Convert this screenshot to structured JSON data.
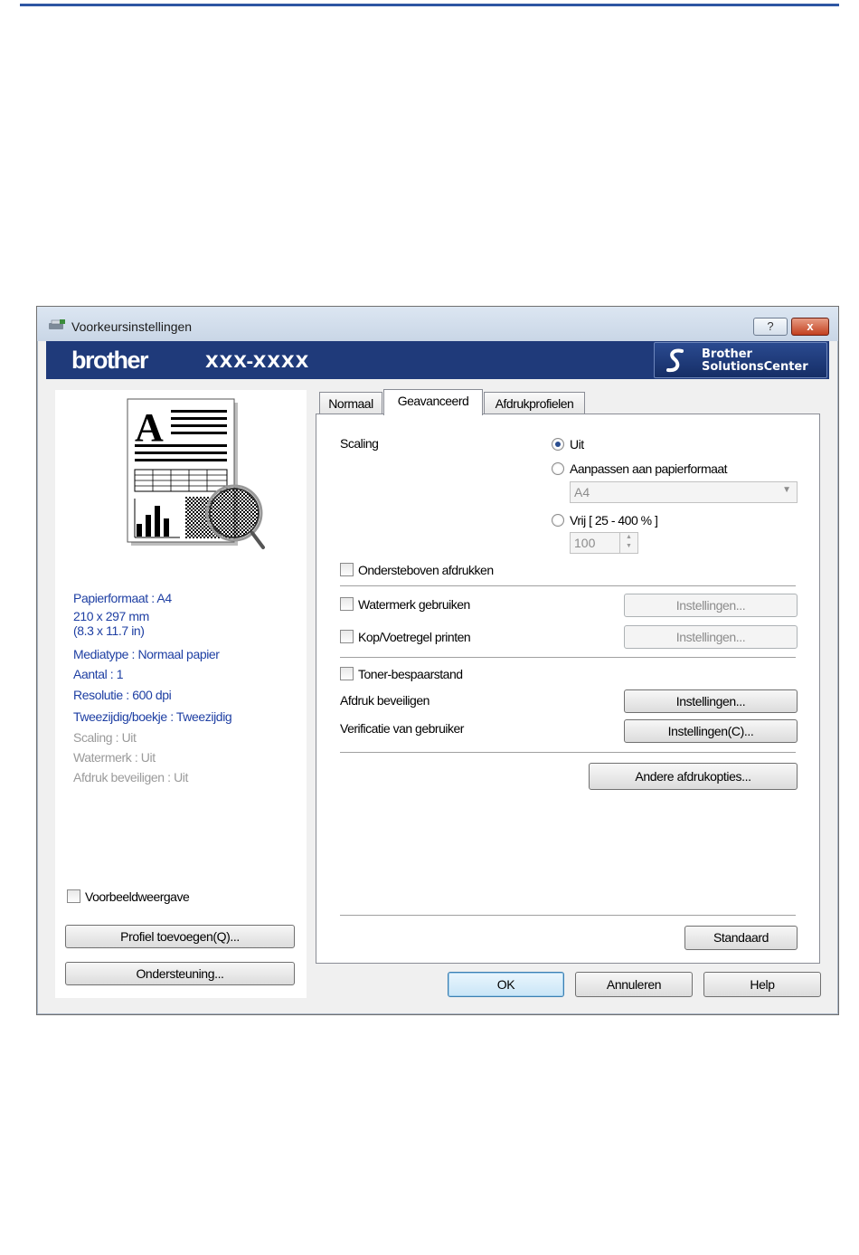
{
  "window": {
    "title": "Voorkeursinstellingen",
    "help_glyph": "?",
    "close_glyph": "x"
  },
  "banner": {
    "brand": "brother",
    "model": "XXX-XXXX",
    "solutions_line1": "Brother",
    "solutions_line2": "SolutionsCenter"
  },
  "summary": {
    "paper_size": "Papierformaat : A4",
    "dimensions_mm": "210 x 297 mm",
    "dimensions_in": "(8.3 x 11.7 in)",
    "media_type": "Mediatype : Normaal papier",
    "copies": "Aantal : 1",
    "resolution": "Resolutie : 600 dpi",
    "duplex": "Tweezijdig/boekje : Tweezijdig",
    "scaling": "Scaling : Uit",
    "watermark": "Watermerk : Uit",
    "secure_print": "Afdruk beveiligen : Uit"
  },
  "left_controls": {
    "preview_label": "Voorbeeldweergave",
    "preview_checked": false,
    "add_profile": "Profiel toevoegen(Q)...",
    "support": "Ondersteuning..."
  },
  "tabs": [
    {
      "label": "Normaal",
      "active": false
    },
    {
      "label": "Geavanceerd",
      "active": true
    },
    {
      "label": "Afdrukprofielen",
      "active": false
    }
  ],
  "advanced": {
    "scaling_label": "Scaling",
    "scaling_options": [
      {
        "label": "Uit",
        "selected": true
      },
      {
        "label": "Aanpassen aan papierformaat",
        "selected": false
      },
      {
        "label": "Vrij [ 25 - 400 % ]",
        "selected": false
      }
    ],
    "paper_combo_value": "A4",
    "free_value": "100",
    "upside_down": {
      "label": "Ondersteboven afdrukken",
      "checked": false
    },
    "watermark": {
      "label": "Watermerk gebruiken",
      "checked": false,
      "button": "Instellingen..."
    },
    "header_footer": {
      "label": "Kop/Voetregel printen",
      "checked": false,
      "button": "Instellingen..."
    },
    "toner_save": {
      "label": "Toner-bespaarstand",
      "checked": false
    },
    "secure_print": {
      "label": "Afdruk beveiligen",
      "button": "Instellingen..."
    },
    "user_verification": {
      "label": "Verificatie van gebruiker",
      "button": "Instellingen(C)..."
    },
    "other_options": "Andere afdrukopties...",
    "default_button": "Standaard"
  },
  "footer": {
    "ok": "OK",
    "cancel": "Annuleren",
    "help": "Help"
  },
  "colors": {
    "accent": "#1f3a7a",
    "summary_text": "#1e3fa3",
    "disabled_text": "#9a9a9a",
    "page_rule": "#2e56a3"
  }
}
